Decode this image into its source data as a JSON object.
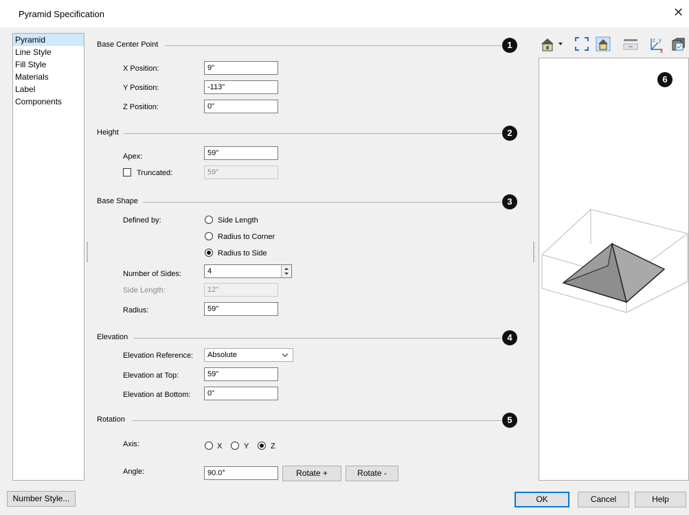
{
  "window": {
    "title": "Pyramid Specification",
    "close_glyph": "✕"
  },
  "sidebar": {
    "items": [
      "Pyramid",
      "Line Style",
      "Fill Style",
      "Materials",
      "Label",
      "Components"
    ],
    "selected_index": 0
  },
  "sections": {
    "base_center": {
      "title": "Base Center Point",
      "badge": "1",
      "x_label": "X Position:",
      "x_value": "9\"",
      "y_label": "Y Position:",
      "y_value": "-113\"",
      "z_label": "Z Position:",
      "z_value": "0\""
    },
    "height": {
      "title": "Height",
      "badge": "2",
      "apex_label": "Apex:",
      "apex_value": "59\"",
      "truncated_label": "Truncated:",
      "truncated_value": "59\"",
      "truncated_checked": false
    },
    "base_shape": {
      "title": "Base Shape",
      "badge": "3",
      "defined_by_label": "Defined by:",
      "options": [
        "Side Length",
        "Radius to Corner",
        "Radius to Side"
      ],
      "selected_option": 2,
      "sides_label": "Number of Sides:",
      "sides_value": "4",
      "side_length_label": "Side Length:",
      "side_length_value": "12\"",
      "radius_label": "Radius:",
      "radius_value": "59\""
    },
    "elevation": {
      "title": "Elevation",
      "badge": "4",
      "reference_label": "Elevation Reference:",
      "reference_value": "Absolute",
      "top_label": "Elevation at Top:",
      "top_value": "59\"",
      "bottom_label": "Elevation at Bottom:",
      "bottom_value": "0\""
    },
    "rotation": {
      "title": "Rotation",
      "badge": "5",
      "axis_label": "Axis:",
      "axes": [
        "X",
        "Y",
        "Z"
      ],
      "selected_axis": 2,
      "angle_label": "Angle:",
      "angle_value": "90.0°",
      "rotate_plus": "Rotate +",
      "rotate_minus": "Rotate -"
    }
  },
  "preview": {
    "badge": "6",
    "toolbar_icons": [
      "camera-view-icon",
      "fill-window-icon",
      "material-view-icon",
      "render-style-icon",
      "axes-icon",
      "box-view-icon"
    ]
  },
  "footer": {
    "number_style": "Number Style...",
    "ok": "OK",
    "cancel": "Cancel",
    "help": "Help"
  }
}
